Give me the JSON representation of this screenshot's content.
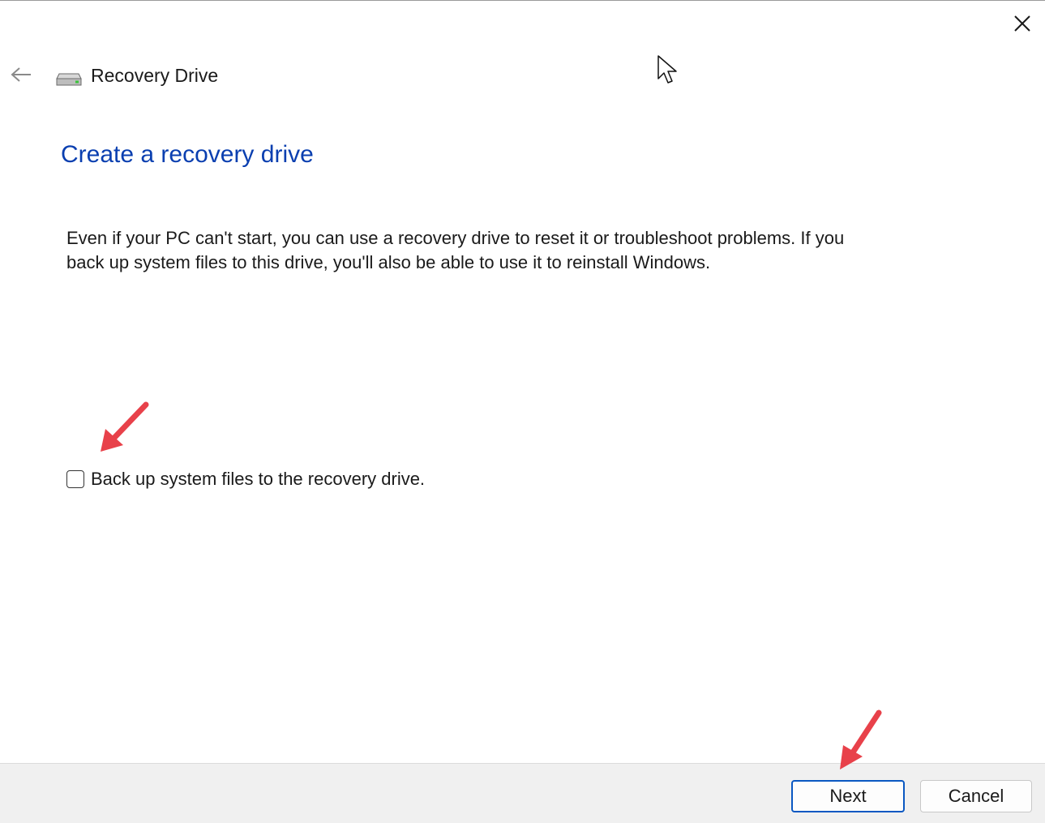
{
  "window": {
    "close_icon": "close-icon",
    "back_icon": "back-arrow-icon",
    "app_icon": "drive-icon",
    "app_title": "Recovery Drive"
  },
  "main": {
    "page_title": "Create a recovery drive",
    "description": "Even if your PC can't start, you can use a recovery drive to reset it or troubleshoot problems. If you back up system files to this drive, you'll also be able to use it to reinstall Windows.",
    "checkbox": {
      "label": "Back up system files to the recovery drive.",
      "checked": false
    }
  },
  "footer": {
    "next_label": "Next",
    "cancel_label": "Cancel"
  },
  "colors": {
    "title_blue": "#0a3fb0",
    "primary_button_border": "#0a58c2",
    "annotation_arrow": "#e8414a",
    "footer_background": "#f0f0f0"
  }
}
